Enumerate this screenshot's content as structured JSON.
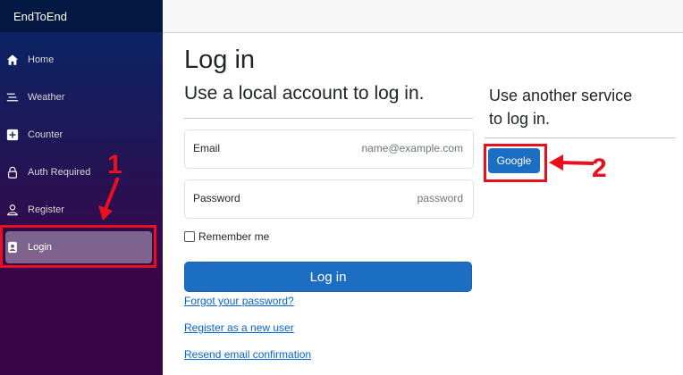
{
  "app": {
    "brand": "EndToEnd"
  },
  "sidebar": {
    "items": [
      {
        "label": "Home",
        "icon": "home-icon"
      },
      {
        "label": "Weather",
        "icon": "list-icon"
      },
      {
        "label": "Counter",
        "icon": "plus-square-icon"
      },
      {
        "label": "Auth Required",
        "icon": "lock-icon"
      },
      {
        "label": "Register",
        "icon": "person-icon"
      },
      {
        "label": "Login",
        "icon": "person-badge-icon",
        "active": true
      }
    ]
  },
  "page": {
    "title": "Log in",
    "local_heading": "Use a local account to log in.",
    "external_heading_line1": "Use another service",
    "external_heading_line2": "to log in."
  },
  "form": {
    "email_label": "Email",
    "email_placeholder": "name@example.com",
    "password_label": "Password",
    "password_placeholder": "password",
    "remember_label": "Remember me",
    "submit_label": "Log in"
  },
  "links": {
    "forgot": "Forgot your password?",
    "register": "Register as a new user",
    "resend": "Resend email confirmation"
  },
  "external": {
    "google_label": "Google"
  },
  "annotations": {
    "callout_1": "1",
    "callout_2": "2"
  },
  "colors": {
    "accent": "#1b6ec2",
    "annotation": "#e8101e",
    "link": "#0366d6"
  }
}
